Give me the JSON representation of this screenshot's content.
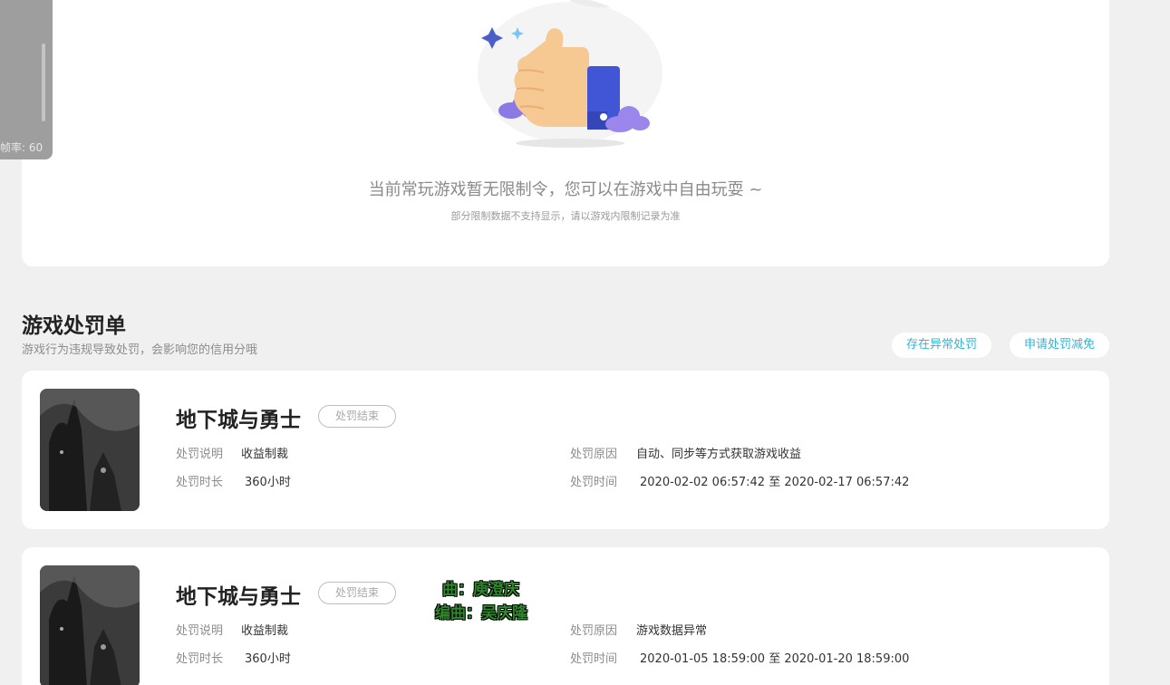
{
  "fps_widget": {
    "label": "帧率: 60"
  },
  "restriction": {
    "empty_title": "当前常玩游戏暂无限制令，您可以在游戏中自由玩耍 ~",
    "empty_sub": "部分限制数据不支持显示，请以游戏内限制记录为准"
  },
  "penalty": {
    "title": "游戏处罚单",
    "subtitle": "游戏行为违规导致处罚，会影响您的信用分哦",
    "btn_abnormal": "存在异常处罚",
    "btn_appeal": "申请处罚减免",
    "labels": {
      "desc": "处罚说明",
      "duration": "处罚时长",
      "reason": "处罚原因",
      "time": "处罚时间"
    },
    "items": [
      {
        "game": "地下城与勇士",
        "status": "处罚结束",
        "desc": "收益制裁",
        "duration": "360小时",
        "reason": "自动、同步等方式获取游戏收益",
        "time": "2020-02-02 06:57:42 至 2020-02-17 06:57:42"
      },
      {
        "game": "地下城与勇士",
        "status": "处罚结束",
        "desc": "收益制裁",
        "duration": "360小时",
        "reason": "游戏数据异常",
        "time": "2020-01-05 18:59:00 至 2020-01-20 18:59:00"
      }
    ]
  },
  "overlay": {
    "line1": "曲：庾澄庆",
    "line2": "编曲：吴庆隆"
  },
  "colors": {
    "accent": "#34b5d6",
    "page_bg": "#f0f0f0",
    "card_bg": "#ffffff"
  }
}
